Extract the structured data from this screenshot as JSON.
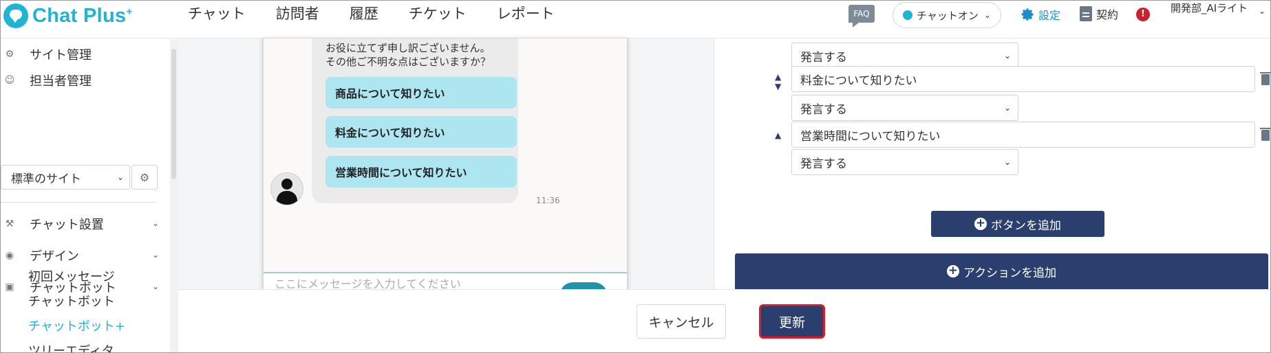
{
  "app": {
    "brand": "Chat Plus",
    "brand_mark": "+",
    "brand_color": "#1fb3d6",
    "accent_navy": "#2b3f6e",
    "highlight_red": "#e0192a"
  },
  "nav": [
    "チャット",
    "訪問者",
    "履歴",
    "チケット",
    "レポート"
  ],
  "header": {
    "faq": "FAQ",
    "status": "チャットオン",
    "settings": "設定",
    "contract": "契約",
    "alert": "!",
    "user": "開発部_AIライト"
  },
  "sidebar": {
    "site_admin": "サイト管理",
    "staff_admin": "担当者管理",
    "site_select": "標準のサイト",
    "items": [
      {
        "label": "チャット設置",
        "icon": "tools-icon"
      },
      {
        "label": "デザイン",
        "icon": "palette-icon"
      },
      {
        "label": "チャットボット",
        "icon": "chat-icon"
      }
    ],
    "subitems": [
      "初回メッセージ",
      "チャットボット",
      "チャットボット+",
      "ツリーエディタ"
    ]
  },
  "preview": {
    "message_line1": "お役に立てず申し訳ございません。",
    "message_line2": "その他ご不明な点はございますか？",
    "choices": [
      "商品について知りたい",
      "料金について知りたい",
      "営業時間について知りたい"
    ],
    "time": "11:36",
    "input_placeholder": "ここにメッセージを入力してください"
  },
  "panel": {
    "action_select": "発言する",
    "buttons": [
      "料金について知りたい",
      "営業時間について知りたい"
    ],
    "add_button": "ボタンを追加",
    "add_action": "アクションを追加"
  },
  "footer": {
    "cancel": "キャンセル",
    "update": "更新"
  }
}
